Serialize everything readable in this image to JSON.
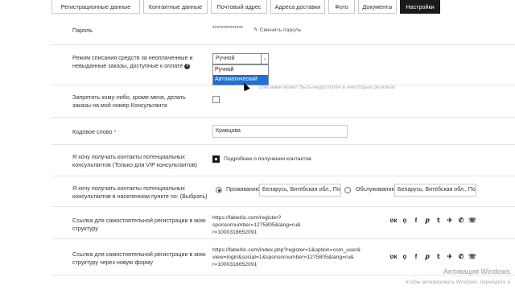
{
  "tabs": [
    {
      "label": "Регистрационные данные",
      "active": false
    },
    {
      "label": "Контактные данные",
      "active": false
    },
    {
      "label": "Почтовый адрес",
      "active": false
    },
    {
      "label": "Адреса доставки",
      "active": false
    },
    {
      "label": "Фото",
      "active": false
    },
    {
      "label": "Документы",
      "active": false
    },
    {
      "label": "Настройки",
      "active": true
    }
  ],
  "password": {
    "label": "Пароль",
    "value": "**************",
    "change_link": "✎ Сменить пароль"
  },
  "debit_mode": {
    "label": "Режим списания средств за неоплаченные и невыданные заказы, доступные к оплате",
    "selected": "Ручной",
    "options": [
      "Ручной",
      "Автоматический"
    ],
    "hint": "списания может быть недоступен в некоторых регионах"
  },
  "forbid_orders": {
    "label": "Запретить кому-либо, кроме меня, делать заказы на мой номер Консультанта",
    "checked": false
  },
  "code_word": {
    "label": "Кодовое слово",
    "required_mark": "*",
    "value": "Кравцова"
  },
  "vip_contacts": {
    "label": "Я хочу получать контакты потенциальных консультантов (Только для VIP консультантов)",
    "checked": true,
    "link": "Подробнее о получении контактов"
  },
  "location_contacts": {
    "label": "Я хочу получать контакты потенциальных консультантов в населенном пункте по: (Выбрать)",
    "option1": "Проживанию",
    "value1": "Беларусь, Витебская обл., По",
    "option2": "Обслуживанию",
    "value2": "Беларусь, Витебская обл., По"
  },
  "reg_link": {
    "label": "Ссылка для самостоятельной регистрации в мою структуру",
    "url_line1": "https://faberlic.com/register?sponsornumber=1275805&lang=ru&",
    "url_line2": "r=1000318652091"
  },
  "reg_link_new": {
    "label": "Ссылка для самостоятельной регистрации в мою структуру через новую форму",
    "url_line1": "https://faberlic.com/index.php?register=1&option=com_user&",
    "url_line2": "view=login&social=1&sponsornumber=1275805&lang=ru&",
    "url_line3": "r=1000318652091"
  },
  "social_icons": [
    "vk-icon",
    "ok-icon",
    "facebook-icon",
    "pinterest-icon",
    "twitter-icon",
    "telegram-icon",
    "whatsapp-icon",
    "viber-icon"
  ],
  "social_glyphs": [
    "ʋк",
    "ọ",
    "f",
    "𝒑",
    "𝕥",
    "✈",
    "✆",
    "☏"
  ],
  "watermark": {
    "title": "Активация Windows",
    "subtitle": "Чтобы активировать Windows, перейдите в"
  }
}
